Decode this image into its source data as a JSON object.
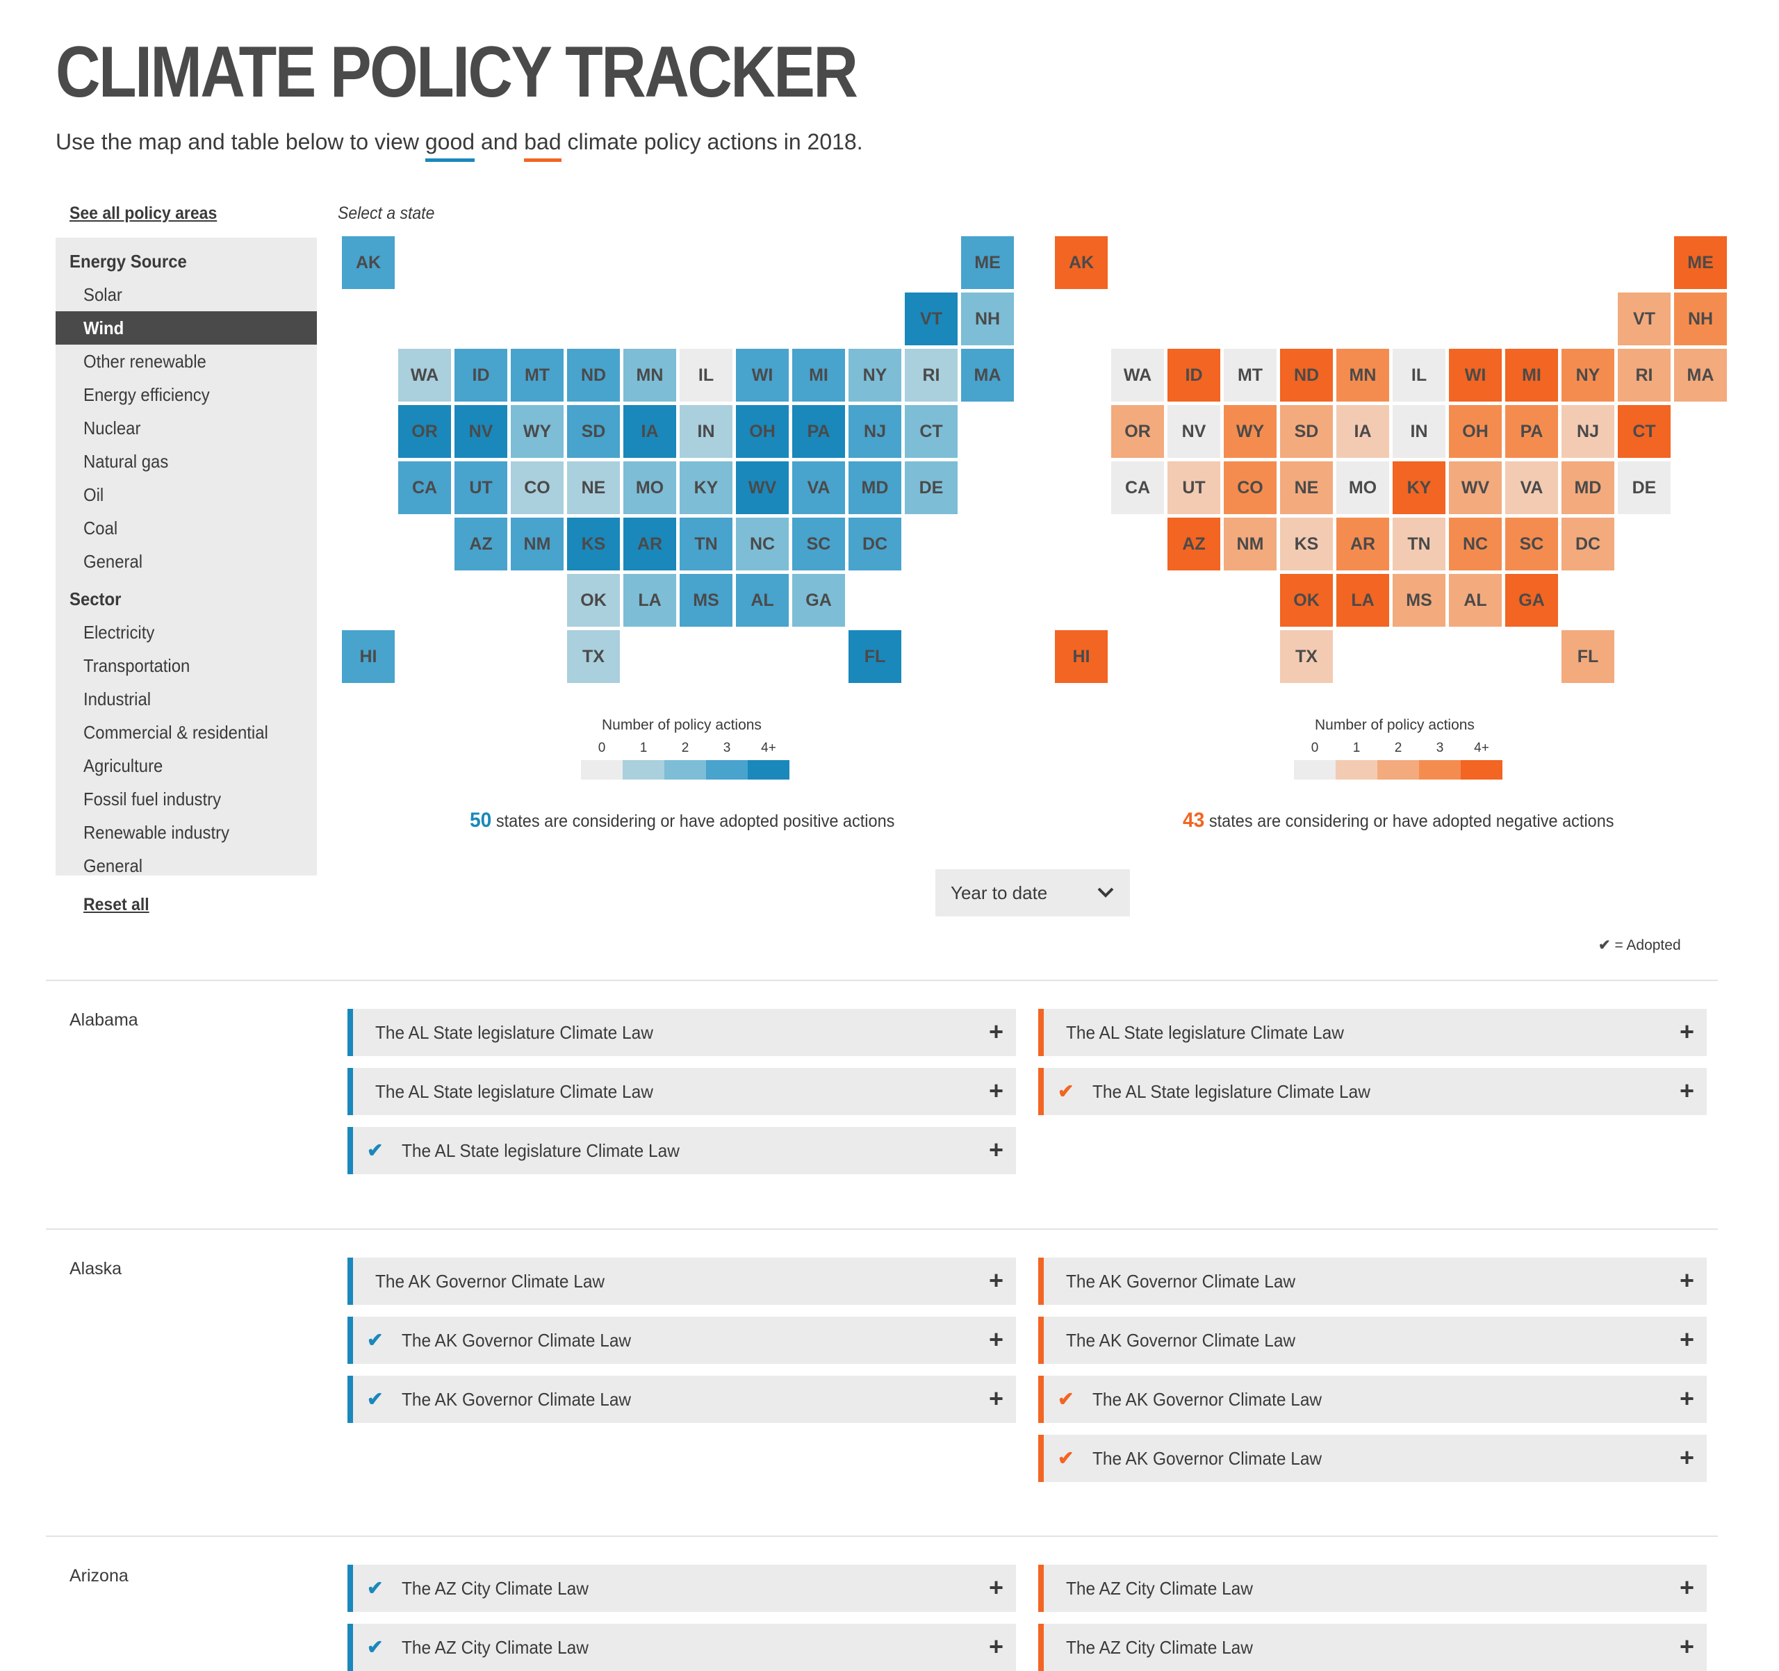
{
  "header": {
    "title": "CLIMATE POLICY TRACKER",
    "subtitle_pre": "Use the map and table below to view ",
    "subtitle_good": "good",
    "subtitle_mid": " and ",
    "subtitle_bad": "bad",
    "subtitle_post": " climate policy actions in 2018."
  },
  "sidebar": {
    "see_all": "See all policy areas",
    "reset": "Reset all",
    "items": [
      {
        "label": "Energy Source",
        "type": "head"
      },
      {
        "label": "Solar",
        "type": "item"
      },
      {
        "label": "Wind",
        "type": "item",
        "active": true
      },
      {
        "label": "Other renewable",
        "type": "item"
      },
      {
        "label": "Energy efficiency",
        "type": "item"
      },
      {
        "label": "Nuclear",
        "type": "item"
      },
      {
        "label": "Natural gas",
        "type": "item"
      },
      {
        "label": "Oil",
        "type": "item"
      },
      {
        "label": "Coal",
        "type": "item"
      },
      {
        "label": "General",
        "type": "item"
      },
      {
        "label": "Sector",
        "type": "head"
      },
      {
        "label": "Electricity",
        "type": "item"
      },
      {
        "label": "Transportation",
        "type": "item"
      },
      {
        "label": "Industrial",
        "type": "item"
      },
      {
        "label": "Commercial & residential",
        "type": "item"
      },
      {
        "label": "Agriculture",
        "type": "item"
      },
      {
        "label": "Fossil fuel industry",
        "type": "item"
      },
      {
        "label": "Renewable industry",
        "type": "item"
      },
      {
        "label": "General",
        "type": "item"
      }
    ]
  },
  "maps": {
    "select_state": "Select a state",
    "legend_title": "Number of policy actions",
    "legend_labels": [
      "0",
      "1",
      "2",
      "3",
      "4+"
    ],
    "grid": [
      {
        "s": "AK",
        "c": 0,
        "r": 0
      },
      {
        "s": "ME",
        "c": 11,
        "r": 0
      },
      {
        "s": "VT",
        "c": 10,
        "r": 1
      },
      {
        "s": "NH",
        "c": 11,
        "r": 1
      },
      {
        "s": "WA",
        "c": 1,
        "r": 2
      },
      {
        "s": "ID",
        "c": 2,
        "r": 2
      },
      {
        "s": "MT",
        "c": 3,
        "r": 2
      },
      {
        "s": "ND",
        "c": 4,
        "r": 2
      },
      {
        "s": "MN",
        "c": 5,
        "r": 2
      },
      {
        "s": "IL",
        "c": 6,
        "r": 2
      },
      {
        "s": "WI",
        "c": 7,
        "r": 2
      },
      {
        "s": "MI",
        "c": 8,
        "r": 2
      },
      {
        "s": "NY",
        "c": 9,
        "r": 2
      },
      {
        "s": "RI",
        "c": 10,
        "r": 2
      },
      {
        "s": "MA",
        "c": 11,
        "r": 2
      },
      {
        "s": "OR",
        "c": 1,
        "r": 3
      },
      {
        "s": "NV",
        "c": 2,
        "r": 3
      },
      {
        "s": "WY",
        "c": 3,
        "r": 3
      },
      {
        "s": "SD",
        "c": 4,
        "r": 3
      },
      {
        "s": "IA",
        "c": 5,
        "r": 3
      },
      {
        "s": "IN",
        "c": 6,
        "r": 3
      },
      {
        "s": "OH",
        "c": 7,
        "r": 3
      },
      {
        "s": "PA",
        "c": 8,
        "r": 3
      },
      {
        "s": "NJ",
        "c": 9,
        "r": 3
      },
      {
        "s": "CT",
        "c": 10,
        "r": 3
      },
      {
        "s": "CA",
        "c": 1,
        "r": 4
      },
      {
        "s": "UT",
        "c": 2,
        "r": 4
      },
      {
        "s": "CO",
        "c": 3,
        "r": 4
      },
      {
        "s": "NE",
        "c": 4,
        "r": 4
      },
      {
        "s": "MO",
        "c": 5,
        "r": 4
      },
      {
        "s": "KY",
        "c": 6,
        "r": 4
      },
      {
        "s": "WV",
        "c": 7,
        "r": 4
      },
      {
        "s": "VA",
        "c": 8,
        "r": 4
      },
      {
        "s": "MD",
        "c": 9,
        "r": 4
      },
      {
        "s": "DE",
        "c": 10,
        "r": 4
      },
      {
        "s": "AZ",
        "c": 2,
        "r": 5
      },
      {
        "s": "NM",
        "c": 3,
        "r": 5
      },
      {
        "s": "KS",
        "c": 4,
        "r": 5
      },
      {
        "s": "AR",
        "c": 5,
        "r": 5
      },
      {
        "s": "TN",
        "c": 6,
        "r": 5
      },
      {
        "s": "NC",
        "c": 7,
        "r": 5
      },
      {
        "s": "SC",
        "c": 8,
        "r": 5
      },
      {
        "s": "DC",
        "c": 9,
        "r": 5
      },
      {
        "s": "OK",
        "c": 4,
        "r": 6
      },
      {
        "s": "LA",
        "c": 5,
        "r": 6
      },
      {
        "s": "MS",
        "c": 6,
        "r": 6
      },
      {
        "s": "AL",
        "c": 7,
        "r": 6
      },
      {
        "s": "GA",
        "c": 8,
        "r": 6
      },
      {
        "s": "HI",
        "c": 0,
        "r": 7
      },
      {
        "s": "TX",
        "c": 4,
        "r": 7
      },
      {
        "s": "FL",
        "c": 9,
        "r": 7
      }
    ],
    "positive": {
      "colors": [
        "#ececec",
        "#aacfdd",
        "#7dbdd6",
        "#48a3cd",
        "#1a88bb"
      ],
      "count": "50",
      "count_color": "#1a88bb",
      "summary": " states are considering or have adopted positive actions",
      "levels": {
        "AK": 3,
        "ME": 3,
        "VT": 4,
        "NH": 2,
        "WA": 1,
        "ID": 3,
        "MT": 3,
        "ND": 3,
        "MN": 2,
        "IL": 0,
        "WI": 3,
        "MI": 3,
        "NY": 2,
        "RI": 1,
        "MA": 3,
        "OR": 4,
        "NV": 4,
        "WY": 2,
        "SD": 3,
        "IA": 4,
        "IN": 1,
        "OH": 4,
        "PA": 4,
        "NJ": 3,
        "CT": 2,
        "CA": 3,
        "UT": 3,
        "CO": 1,
        "NE": 1,
        "MO": 2,
        "KY": 2,
        "WV": 4,
        "VA": 3,
        "MD": 3,
        "DE": 2,
        "AZ": 3,
        "NM": 3,
        "KS": 4,
        "AR": 4,
        "TN": 3,
        "NC": 2,
        "SC": 3,
        "DC": 3,
        "OK": 1,
        "LA": 2,
        "MS": 3,
        "AL": 3,
        "GA": 2,
        "HI": 3,
        "TX": 1,
        "FL": 4
      }
    },
    "negative": {
      "colors": [
        "#ececec",
        "#f3cbb3",
        "#f3aa7d",
        "#f58c4f",
        "#f26522"
      ],
      "count": "43",
      "count_color": "#f26522",
      "summary": " states are considering or have adopted negative actions",
      "levels": {
        "AK": 4,
        "ME": 4,
        "VT": 2,
        "NH": 3,
        "WA": 0,
        "ID": 4,
        "MT": 0,
        "ND": 4,
        "MN": 3,
        "IL": 0,
        "WI": 4,
        "MI": 4,
        "NY": 3,
        "RI": 2,
        "MA": 2,
        "OR": 2,
        "NV": 0,
        "WY": 3,
        "SD": 2,
        "IA": 1,
        "IN": 0,
        "OH": 3,
        "PA": 3,
        "NJ": 1,
        "CT": 4,
        "CA": 0,
        "UT": 1,
        "CO": 3,
        "NE": 2,
        "MO": 0,
        "KY": 4,
        "WV": 2,
        "VA": 1,
        "MD": 2,
        "DE": 0,
        "AZ": 4,
        "NM": 2,
        "KS": 1,
        "AR": 3,
        "TN": 1,
        "NC": 3,
        "SC": 3,
        "DC": 2,
        "OK": 4,
        "LA": 4,
        "MS": 2,
        "AL": 2,
        "GA": 4,
        "HI": 4,
        "TX": 1,
        "FL": 2
      }
    }
  },
  "controls": {
    "dropdown_value": "Year to date",
    "adopted_key": "= Adopted"
  },
  "states": [
    {
      "name": "Alabama",
      "positive": [
        {
          "label": "The AL State legislature Climate Law",
          "adopted": false
        },
        {
          "label": "The AL State legislature Climate Law",
          "adopted": false
        },
        {
          "label": "The AL State legislature Climate Law",
          "adopted": true
        }
      ],
      "negative": [
        {
          "label": "The AL State legislature Climate Law",
          "adopted": false
        },
        {
          "label": "The AL State legislature Climate Law",
          "adopted": true
        }
      ]
    },
    {
      "name": "Alaska",
      "positive": [
        {
          "label": "The AK Governor Climate Law",
          "adopted": false
        },
        {
          "label": "The AK Governor Climate Law",
          "adopted": true
        },
        {
          "label": "The AK Governor Climate Law",
          "adopted": true
        }
      ],
      "negative": [
        {
          "label": "The AK Governor Climate Law",
          "adopted": false
        },
        {
          "label": "The AK Governor Climate Law",
          "adopted": false
        },
        {
          "label": "The AK Governor Climate Law",
          "adopted": true
        },
        {
          "label": "The AK Governor Climate Law",
          "adopted": true
        }
      ]
    },
    {
      "name": "Arizona",
      "positive": [
        {
          "label": "The AZ City Climate Law",
          "adopted": true
        },
        {
          "label": "The AZ City Climate Law",
          "adopted": true
        }
      ],
      "negative": [
        {
          "label": "The AZ City Climate Law",
          "adopted": false
        },
        {
          "label": "The AZ City Climate Law",
          "adopted": false
        }
      ]
    }
  ],
  "icons": {
    "check": "check-icon",
    "plus": "plus-icon",
    "chevron": "chevron-down-icon"
  },
  "colors": {
    "good": "#1a88bb",
    "bad": "#f26522",
    "panel": "#ebebeb"
  }
}
